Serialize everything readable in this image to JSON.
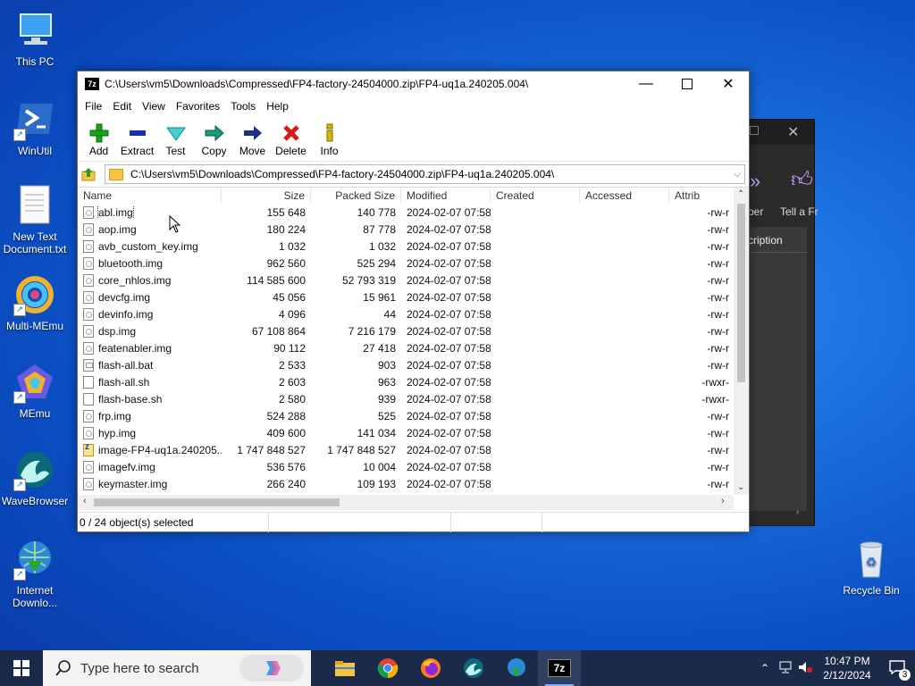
{
  "desktop": {
    "icons": [
      {
        "label": "This PC"
      },
      {
        "label": "WinUtil"
      },
      {
        "label": "New Text Document.txt"
      },
      {
        "label": "Multi-MEmu"
      },
      {
        "label": "MEmu"
      },
      {
        "label": "WaveBrowser"
      },
      {
        "label": "Internet Downlo..."
      },
      {
        "label": "Recycle Bin"
      }
    ]
  },
  "bgwindow": {
    "partial_labels": [
      "ber",
      "Tell a Fr",
      "cription"
    ]
  },
  "window": {
    "title": "C:\\Users\\vm5\\Downloads\\Compressed\\FP4-factory-24504000.zip\\FP4-uq1a.240205.004\\",
    "app_icon_text": "7z",
    "menu": [
      "File",
      "Edit",
      "View",
      "Favorites",
      "Tools",
      "Help"
    ],
    "toolbar": [
      {
        "label": "Add",
        "icon": "plus-icon",
        "color": "#1aa31a"
      },
      {
        "label": "Extract",
        "icon": "minus-icon",
        "color": "#1a2ea8"
      },
      {
        "label": "Test",
        "icon": "check-icon",
        "color": "#1cb8b8"
      },
      {
        "label": "Copy",
        "icon": "double-arrow-icon",
        "color": "#1a8a6a"
      },
      {
        "label": "Move",
        "icon": "arrow-right-icon",
        "color": "#1a2e8a"
      },
      {
        "label": "Delete",
        "icon": "x-icon",
        "color": "#d81a1a"
      },
      {
        "label": "Info",
        "icon": "info-icon",
        "color": "#c8a000"
      }
    ],
    "address": "C:\\Users\\vm5\\Downloads\\Compressed\\FP4-factory-24504000.zip\\FP4-uq1a.240205.004\\",
    "columns": [
      "Name",
      "Size",
      "Packed Size",
      "Modified",
      "Created",
      "Accessed",
      "Attrib"
    ],
    "rows": [
      {
        "name": "abl.img",
        "type": "img",
        "size": "155 648",
        "packed": "140 778",
        "modified": "2024-02-07 07:58",
        "created": "",
        "accessed": "",
        "attr": "-rw-r"
      },
      {
        "name": "aop.img",
        "type": "img",
        "size": "180 224",
        "packed": "87 778",
        "modified": "2024-02-07 07:58",
        "created": "",
        "accessed": "",
        "attr": "-rw-r"
      },
      {
        "name": "avb_custom_key.img",
        "type": "img",
        "size": "1 032",
        "packed": "1 032",
        "modified": "2024-02-07 07:58",
        "created": "",
        "accessed": "",
        "attr": "-rw-r"
      },
      {
        "name": "bluetooth.img",
        "type": "img",
        "size": "962 560",
        "packed": "525 294",
        "modified": "2024-02-07 07:58",
        "created": "",
        "accessed": "",
        "attr": "-rw-r"
      },
      {
        "name": "core_nhlos.img",
        "type": "img",
        "size": "114 585 600",
        "packed": "52 793 319",
        "modified": "2024-02-07 07:58",
        "created": "",
        "accessed": "",
        "attr": "-rw-r"
      },
      {
        "name": "devcfg.img",
        "type": "img",
        "size": "45 056",
        "packed": "15 961",
        "modified": "2024-02-07 07:58",
        "created": "",
        "accessed": "",
        "attr": "-rw-r"
      },
      {
        "name": "devinfo.img",
        "type": "img",
        "size": "4 096",
        "packed": "44",
        "modified": "2024-02-07 07:58",
        "created": "",
        "accessed": "",
        "attr": "-rw-r"
      },
      {
        "name": "dsp.img",
        "type": "img",
        "size": "67 108 864",
        "packed": "7 216 179",
        "modified": "2024-02-07 07:58",
        "created": "",
        "accessed": "",
        "attr": "-rw-r"
      },
      {
        "name": "featenabler.img",
        "type": "img",
        "size": "90 112",
        "packed": "27 418",
        "modified": "2024-02-07 07:58",
        "created": "",
        "accessed": "",
        "attr": "-rw-r"
      },
      {
        "name": "flash-all.bat",
        "type": "bat",
        "size": "2 533",
        "packed": "903",
        "modified": "2024-02-07 07:58",
        "created": "",
        "accessed": "",
        "attr": "-rw-r"
      },
      {
        "name": "flash-all.sh",
        "type": "sh",
        "size": "2 603",
        "packed": "963",
        "modified": "2024-02-07 07:58",
        "created": "",
        "accessed": "",
        "attr": "-rwxr-"
      },
      {
        "name": "flash-base.sh",
        "type": "sh",
        "size": "2 580",
        "packed": "939",
        "modified": "2024-02-07 07:58",
        "created": "",
        "accessed": "",
        "attr": "-rwxr-"
      },
      {
        "name": "frp.img",
        "type": "img",
        "size": "524 288",
        "packed": "525",
        "modified": "2024-02-07 07:58",
        "created": "",
        "accessed": "",
        "attr": "-rw-r"
      },
      {
        "name": "hyp.img",
        "type": "img",
        "size": "409 600",
        "packed": "141 034",
        "modified": "2024-02-07 07:58",
        "created": "",
        "accessed": "",
        "attr": "-rw-r"
      },
      {
        "name": "image-FP4-uq1a.240205...",
        "type": "zip",
        "size": "1 747 848 527",
        "packed": "1 747 848 527",
        "modified": "2024-02-07 07:58",
        "created": "",
        "accessed": "",
        "attr": "-rw-r"
      },
      {
        "name": "imagefv.img",
        "type": "img",
        "size": "536 576",
        "packed": "10 004",
        "modified": "2024-02-07 07:58",
        "created": "",
        "accessed": "",
        "attr": "-rw-r"
      },
      {
        "name": "keymaster.img",
        "type": "img",
        "size": "266 240",
        "packed": "109 193",
        "modified": "2024-02-07 07:58",
        "created": "",
        "accessed": "",
        "attr": "-rw-r"
      }
    ],
    "status": "0 / 24 object(s) selected"
  },
  "taskbar": {
    "search_placeholder": "Type here to search",
    "time": "10:47 PM",
    "date": "2/12/2024",
    "notification_count": "3"
  }
}
